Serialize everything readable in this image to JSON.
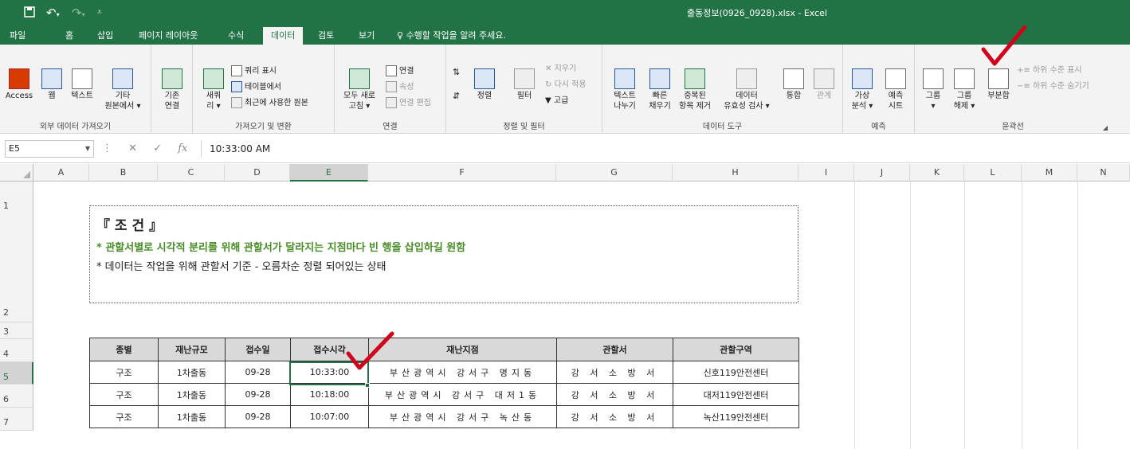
{
  "window": {
    "title": "출동정보(0926_0928).xlsx - Excel"
  },
  "menu": {
    "tabs": [
      "파일",
      "홈",
      "삽입",
      "페이지 레이아웃",
      "수식",
      "데이터",
      "검토",
      "보기"
    ],
    "active": "데이터",
    "tellme": "수행할 작업을 알려 주세요."
  },
  "ribbon": {
    "external": {
      "label": "외부 데이터 가져오기",
      "access": "Access",
      "web": "웹",
      "text": "텍스트",
      "other1": "기타",
      "other2": "원본에서 ▾",
      "existing1": "기존",
      "existing2": "연결"
    },
    "transform": {
      "label": "가져오기 및 변환",
      "newq1": "새쿼",
      "newq2": "리 ▾",
      "showq": "쿼리 표시",
      "fromtable": "테이블에서",
      "recent": "최근에 사용한 원본"
    },
    "connections": {
      "label": "연결",
      "refresh1": "모두 새로",
      "refresh2": "고침 ▾",
      "conn": "연결",
      "props": "속성",
      "editlinks": "연결 편집"
    },
    "sortfilter": {
      "label": "정렬 및 필터",
      "sort": "정렬",
      "filter": "필터",
      "clear": "지우기",
      "reapply": "다시 적용",
      "advanced": "고급"
    },
    "datatools": {
      "label": "데이터 도구",
      "t2c1": "텍스트",
      "t2c2": "나누기",
      "flash1": "빠른",
      "flash2": "채우기",
      "dup1": "중복된",
      "dup2": "항목 제거",
      "val1": "데이터",
      "val2": "유효성 검사 ▾",
      "consolidate": "통합",
      "relations": "관계"
    },
    "forecast": {
      "label": "예측",
      "whatif1": "가상",
      "whatif2": "분석 ▾",
      "sheet1": "예측",
      "sheet2": "시트"
    },
    "outline": {
      "label": "윤곽선",
      "group1": "그룹",
      "group2": "▾",
      "ungroup1": "그룹",
      "ungroup2": "해제 ▾",
      "subtotal": "부분합",
      "show": "하위 수준 표시",
      "hide": "하위 수준 숨기기"
    }
  },
  "formula": {
    "cell": "E5",
    "value": "10:33:00 AM",
    "fx": "fx"
  },
  "columns": [
    "A",
    "B",
    "C",
    "D",
    "E",
    "F",
    "G",
    "H",
    "I",
    "J",
    "K",
    "L",
    "M",
    "N"
  ],
  "rows": [
    "1",
    "2",
    "3",
    "4",
    "5",
    "6",
    "7"
  ],
  "note": {
    "title": "『 조 건 』",
    "line1": "* 관할서별로 시각적 분리를 위해 관할서가 달라지는 지점마다 빈 행을 삽입하길 원함",
    "line2": "* 데이터는 작업을 위해  관할서 기준 - 오름차순 정렬 되어있는 상태"
  },
  "table": {
    "headers": [
      "종별",
      "재난규모",
      "접수일",
      "접수시각",
      "재난지점",
      "관할서",
      "관할구역"
    ],
    "rows": [
      [
        "구조",
        "1차출동",
        "09-28",
        "10:33:00",
        "부산광역시 강서구 명지동",
        "강 서 소 방 서",
        "신호119안전센터"
      ],
      [
        "구조",
        "1차출동",
        "09-28",
        "10:18:00",
        "부산광역시 강서구 대저1동",
        "강 서 소 방 서",
        "대저119안전센터"
      ],
      [
        "구조",
        "1차출동",
        "09-28",
        "10:07:00",
        "부산광역시 강서구 녹산동",
        "강 서 소 방 서",
        "녹산119안전센터"
      ]
    ]
  },
  "colors": {
    "excel_green": "#217346",
    "check_red": "#d0021b",
    "note_green": "#4a8c2a"
  }
}
